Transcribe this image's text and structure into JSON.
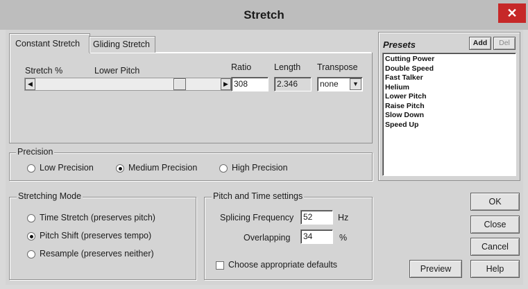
{
  "window": {
    "title": "Stretch",
    "close_glyph": "✕"
  },
  "tabs": [
    {
      "label": "Constant Stretch",
      "active": true
    },
    {
      "label": "Gliding Stretch",
      "active": false
    }
  ],
  "stretch": {
    "stretch_pct_label": "Stretch %",
    "lower_pitch_label": "Lower Pitch",
    "slider_fraction": 0.8,
    "ratio_label": "Ratio",
    "ratio_value": "308",
    "length_label": "Length",
    "length_value": "2.346",
    "transpose_label": "Transpose",
    "transpose_value": "none",
    "left_arrow": "◀",
    "right_arrow": "▶",
    "dropdown_arrow": "▼"
  },
  "precision": {
    "legend": "Precision",
    "options": [
      {
        "label": "Low Precision",
        "selected": false
      },
      {
        "label": "Medium Precision",
        "selected": true
      },
      {
        "label": "High Precision",
        "selected": false
      }
    ]
  },
  "stretching_mode": {
    "legend": "Stretching Mode",
    "options": [
      {
        "label": "Time Stretch (preserves pitch)",
        "selected": false
      },
      {
        "label": "Pitch Shift (preserves tempo)",
        "selected": true
      },
      {
        "label": "Resample (preserves neither)",
        "selected": false
      }
    ]
  },
  "pitch_time": {
    "legend": "Pitch and Time settings",
    "splicing_label": "Splicing Frequency",
    "splicing_value": "52",
    "splicing_unit": "Hz",
    "overlapping_label": "Overlapping",
    "overlapping_value": "34",
    "overlapping_unit": "%",
    "defaults_label": "Choose appropriate defaults",
    "defaults_checked": false
  },
  "presets": {
    "title": "Presets",
    "add_label": "Add",
    "del_label": "Del",
    "items": [
      "Cutting Power",
      "Double Speed",
      "Fast Talker",
      "Helium",
      "Lower Pitch",
      "Raise Pitch",
      "Slow Down",
      "Speed Up"
    ]
  },
  "buttons": {
    "ok": "OK",
    "close": "Close",
    "cancel": "Cancel",
    "preview": "Preview",
    "help": "Help"
  }
}
